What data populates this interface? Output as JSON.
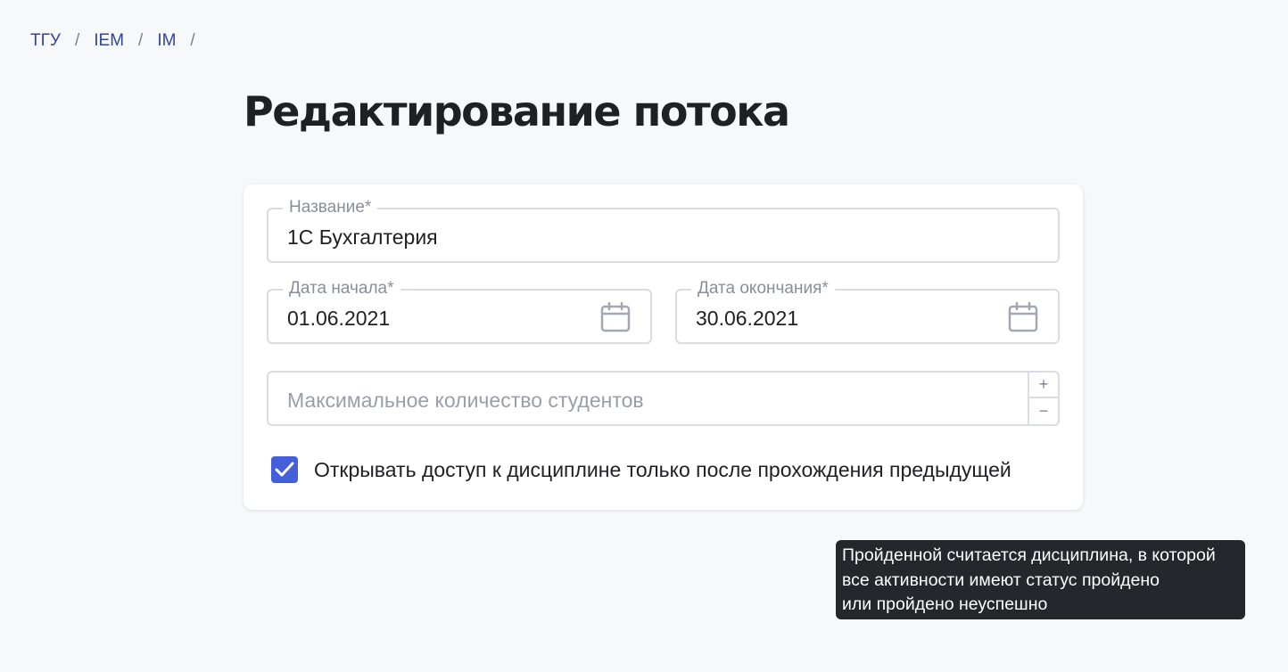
{
  "breadcrumb": {
    "items": [
      "ТГУ",
      "IEM",
      "IM"
    ],
    "separator": "/"
  },
  "page": {
    "title": "Редактирование потока"
  },
  "form": {
    "name": {
      "label": "Название*",
      "value": "1С Бухгалтерия"
    },
    "start_date": {
      "label": "Дата начала*",
      "value": "01.06.2021",
      "icon": "calendar-icon"
    },
    "end_date": {
      "label": "Дата окончания*",
      "value": "30.06.2021",
      "icon": "calendar-icon"
    },
    "max_students": {
      "placeholder": "Максимальное количество студентов",
      "increment": "+",
      "decrement": "−"
    },
    "sequential_access": {
      "label": "Открывать доступ к дисциплине только после прохождения предыдущей",
      "checked": true
    }
  },
  "tooltip": {
    "lines": [
      "Пройденной считается дисциплина, в которой",
      "все активности имеют статус пройдено",
      "или пройдено неуспешно"
    ]
  },
  "colors": {
    "accent": "#4460d8",
    "background": "#f7f8fa",
    "tooltip_bg": "#25272d"
  }
}
